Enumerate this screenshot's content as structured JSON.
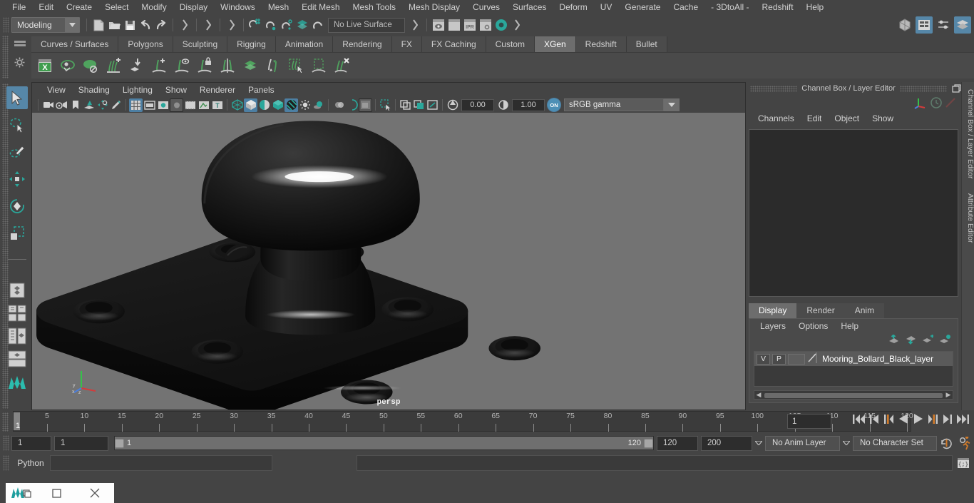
{
  "menubar": {
    "items": [
      "File",
      "Edit",
      "Create",
      "Select",
      "Modify",
      "Display",
      "Windows",
      "Mesh",
      "Edit Mesh",
      "Mesh Tools",
      "Mesh Display",
      "Curves",
      "Surfaces",
      "Deform",
      "UV",
      "Generate",
      "Cache",
      "- 3DtoAll -",
      "Redshift",
      "Help"
    ]
  },
  "statusline": {
    "menuset": "Modeling",
    "live_surface": "No Live Surface",
    "icons": [
      "new-scene-icon",
      "open-scene-icon",
      "save-scene-icon",
      "undo-icon",
      "redo-icon",
      "select-by-hierarchy-icon",
      "select-by-object-icon",
      "select-by-component-icon",
      "snap-to-grid-icon",
      "snap-to-curve-icon",
      "snap-to-point-icon",
      "snap-to-projected-center-icon",
      "snap-to-view-plane-icon",
      "render-current-frame-icon",
      "render-sequence-icon",
      "ipr-render-icon",
      "render-settings-icon",
      "hypershade-icon"
    ],
    "right_icons": [
      "toggle-modeling-toolkit-icon",
      "toggle-attribute-editor-icon",
      "toggle-tool-settings-icon",
      "toggle-channel-box-icon"
    ]
  },
  "shelf": {
    "tabs": [
      "Curves / Surfaces",
      "Polygons",
      "Sculpting",
      "Rigging",
      "Animation",
      "Rendering",
      "FX",
      "FX Caching",
      "Custom",
      "XGen",
      "Redshift",
      "Bullet"
    ],
    "active_tab": "XGen",
    "icons": [
      "xgen-editor-icon",
      "preview-refresh-icon",
      "disable-preview-icon",
      "add-description-icon",
      "import-collection-icon",
      "add-guide-icon",
      "guide-visibility-icon",
      "lock-guide-icon",
      "mirror-guides-icon",
      "density-mask-icon",
      "convert-to-interactive-icon",
      "select-region-icon",
      "place-region-icon",
      "delete-description-icon"
    ]
  },
  "toolbox": {
    "tools": [
      "select-tool",
      "lasso-select-tool",
      "paint-select-tool",
      "move-tool",
      "rotate-tool",
      "scale-tool",
      "last-tool-used",
      "four-view-layout-icon",
      "single-perspective-layout-icon",
      "outliner-persp-layout-icon",
      "persp-graph-layout-icon",
      "maya-logo-icon"
    ],
    "active": "select-tool"
  },
  "viewport_panel": {
    "menus": [
      "View",
      "Shading",
      "Lighting",
      "Show",
      "Renderer",
      "Panels"
    ],
    "camera_label": "persp",
    "toolbar": {
      "exposure_value": "0.00",
      "gamma_value": "1.00",
      "color_management": "sRGB gamma",
      "icons": [
        "select-camera-icon",
        "camera-attributes-icon",
        "bookmark-icon",
        "image-plane-icon",
        "two-d-pan-zoom-icon",
        "grease-pencil-icon",
        "grid-toggle-icon",
        "film-gate-icon",
        "resolution-gate-icon",
        "gate-mask-icon",
        "film-origin-icon",
        "xray-icon",
        "heads-up-display-icon",
        "wireframe-icon",
        "smooth-shade-all-icon",
        "shaded-wireframe-icon",
        "textured-icon",
        "use-all-lights-icon",
        "shadows-icon",
        "screen-space-ao-icon",
        "motion-blur-icon",
        "multisample-icon",
        "depth-of-field-icon",
        "isolate-select-icon",
        "xray-joints-icon",
        "xray-active-components-icon",
        "exposure-icon",
        "gamma-icon",
        "color-management-toggle-icon"
      ]
    }
  },
  "channel_box": {
    "title": "Channel Box / Layer Editor",
    "window_buttons": [
      "undock-icon",
      "close-icon"
    ],
    "header_icons": [
      "axis-indicator-icon",
      "clock-icon",
      "red-slash-icon"
    ],
    "menus": [
      "Channels",
      "Edit",
      "Object",
      "Show"
    ],
    "side_tabs": [
      "Channel Box / Layer Editor",
      "Attribute Editor"
    ]
  },
  "layer_editor": {
    "tabs": [
      "Display",
      "Render",
      "Anim"
    ],
    "active_tab": "Display",
    "menus": [
      "Layers",
      "Options",
      "Help"
    ],
    "buttons": [
      "move-layer-up-icon",
      "move-layer-down-icon",
      "create-empty-layer-icon",
      "create-layer-from-selected-icon"
    ],
    "layers": [
      {
        "visibility": "V",
        "playback": "P",
        "color": "",
        "name": "Mooring_Bollard_Black_layer"
      }
    ]
  },
  "timeline": {
    "ticks": [
      5,
      10,
      15,
      20,
      25,
      30,
      35,
      40,
      45,
      50,
      55,
      60,
      65,
      70,
      75,
      80,
      85,
      90,
      95,
      100,
      105,
      110,
      115,
      120
    ],
    "range_start": 1,
    "range_end": 120,
    "current_frame": "1",
    "current_frame_label": "1",
    "end_label": "12",
    "playback_buttons": [
      "go-to-start-icon",
      "step-back-frame-icon",
      "step-back-key-icon",
      "play-backwards-icon",
      "play-forwards-icon",
      "step-forward-key-icon",
      "step-forward-frame-icon",
      "go-to-end-icon"
    ]
  },
  "range_slider": {
    "anim_start": "1",
    "range_start": "1",
    "slider_start_label": "1",
    "slider_end_label": "120",
    "range_end": "120",
    "anim_end": "200",
    "anim_layer": "No Anim Layer",
    "character_set": "No Character Set",
    "right_icons": [
      "auto-key-icon",
      "animation-preferences-icon"
    ]
  },
  "command_line": {
    "language": "Python",
    "input_value": "",
    "script-editor-icon": "script-editor-icon"
  },
  "taskbar": {
    "items": [
      "maya-app-icon",
      "restore-window-icon",
      "close-window-icon"
    ]
  },
  "colors": {
    "accent_blue": "#5687a8",
    "shelf_green": "#5aa86a",
    "teal": "#29a8a8",
    "orange": "#d07a2a",
    "bg": "#444444",
    "viewport_bg": "#737373"
  }
}
